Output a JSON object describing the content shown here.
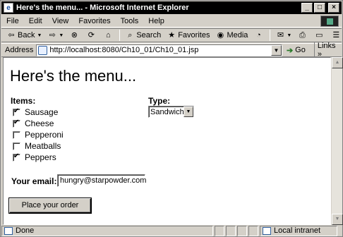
{
  "window": {
    "title": "Here's the menu... - Microsoft Internet Explorer"
  },
  "menubar": {
    "items": [
      "File",
      "Edit",
      "View",
      "Favorites",
      "Tools",
      "Help"
    ]
  },
  "toolbar": {
    "back": "Back",
    "search": "Search",
    "favorites": "Favorites",
    "media": "Media"
  },
  "address": {
    "label": "Address",
    "url": "http://localhost:8080/Ch10_01/Ch10_01.jsp",
    "go": "Go",
    "links": "Links"
  },
  "page": {
    "heading": "Here's the menu...",
    "items_label": "Items:",
    "items": [
      {
        "label": "Sausage",
        "checked": true
      },
      {
        "label": "Cheese",
        "checked": true
      },
      {
        "label": "Pepperoni",
        "checked": false
      },
      {
        "label": "Meatballs",
        "checked": false
      },
      {
        "label": "Peppers",
        "checked": true
      }
    ],
    "type_label": "Type:",
    "type_value": "Sandwich",
    "email_label": "Your email:",
    "email_value": "hungry@starpowder.com",
    "submit_label": "Place your order"
  },
  "status": {
    "text": "Done",
    "zone": "Local intranet"
  }
}
